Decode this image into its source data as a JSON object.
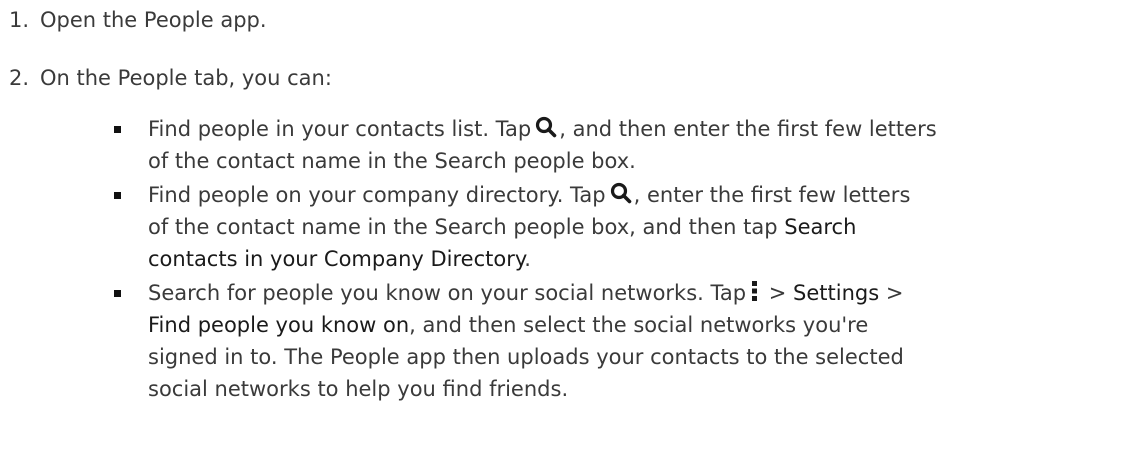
{
  "steps": [
    {
      "number": "1.",
      "text": "Open the People app."
    },
    {
      "number": "2.",
      "text": "On the People tab, you can:"
    }
  ],
  "bullets": {
    "b1": {
      "part1": "Find people in your contacts list. Tap",
      "part2": ", and then enter the first few letters",
      "part3": "of the contact name in the Search people box."
    },
    "b2": {
      "part1": "Find people on your company directory. Tap",
      "part2": ", enter the first few letters",
      "part3": "of the contact name in the Search people box, and then tap",
      "highlight1": "Search",
      "highlight2": "contacts in your Company Directory",
      "part4": "."
    },
    "b3": {
      "part1": "Search for people you know on your social networks. Tap",
      "sep1": ">",
      "highlight1": "Settings",
      "sep2": ">",
      "highlight2": "Find people you know on",
      "part2": ", and then select the social networks you're",
      "part3": "signed in to. The People app then uploads your contacts to the selected",
      "part4": "social networks to help you find friends."
    }
  },
  "icons": {
    "search": "search-icon",
    "menu": "overflow-menu-icon"
  }
}
